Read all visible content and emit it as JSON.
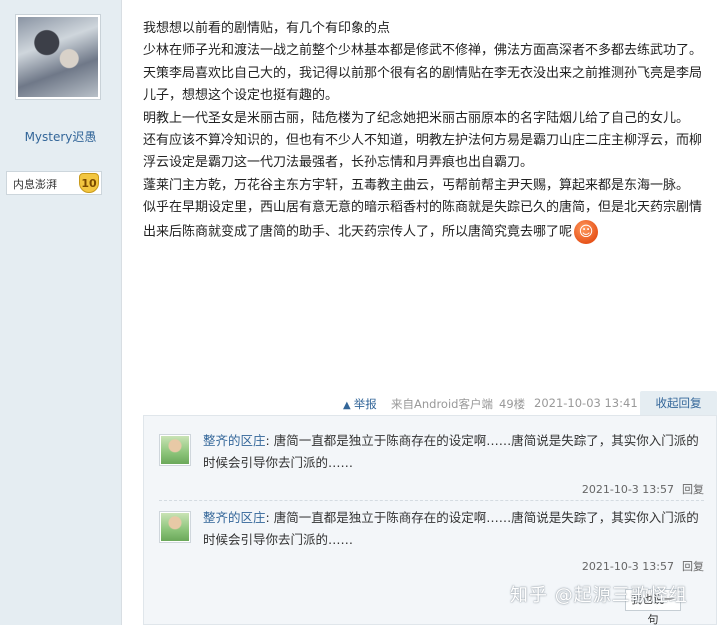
{
  "user": {
    "name": "Mystery迟愚",
    "badge_text": "内息澎湃",
    "level": "10"
  },
  "post": {
    "paragraphs": [
      "我想想以前看的剧情贴，有几个有印象的点",
      "少林在师子光和渡法一战之前整个少林基本都是修武不修禅，佛法方面高深者不多都去练武功了。",
      "天策李局喜欢比自己大的，我记得以前那个很有名的剧情贴在李无衣没出来之前推测孙飞亮是李局儿子，想想这个设定也挺有趣的。",
      "明教上一代圣女是米丽古丽，陆危楼为了纪念她把米丽古丽原本的名字陆烟儿给了自己的女儿。",
      "还有应该不算冷知识的，但也有不少人不知道，明教左护法何方易是霸刀山庄二庄主柳浮云，而柳浮云设定是霸刀这一代刀法最强者，长孙忘情和月弄痕也出自霸刀。",
      "蓬莱门主方乾，万花谷主东方宇轩，五毒教主曲云，丐帮前帮主尹天赐，算起来都是东海一脉。",
      "似乎在早期设定里，西山居有意无意的暗示稻香村的陈商就是失踪已久的唐简，但是北天药宗剧情出来后陈商就变成了唐简的助手、北天药宗传人了，所以唐简究竟去哪了呢"
    ],
    "emoji": "smiley-face-icon"
  },
  "meta": {
    "report_label": "举报",
    "client_label": "来自Android客户端",
    "floor_label": "49楼",
    "datetime": "2021-10-03 13:41",
    "collapse_reply_label": "收起回复"
  },
  "replies": [
    {
      "author": "整齐的区庄",
      "text": ": 唐简一直都是独立于陈商存在的设定啊……唐简说是失踪了，其实你入门派的时候会引导你去门派的……",
      "time": "2021-10-3 13:57",
      "reply_label": "回复"
    },
    {
      "author": "整齐的区庄",
      "text": ": 唐简一直都是独立于陈商存在的设定啊……唐简说是失踪了，其实你入门派的时候会引导你去门派的……",
      "time": "2021-10-3 13:57",
      "reply_label": "回复"
    }
  ],
  "watermark": "知乎 @起源三歌怪组",
  "bottom_button_label": "我也说一句"
}
